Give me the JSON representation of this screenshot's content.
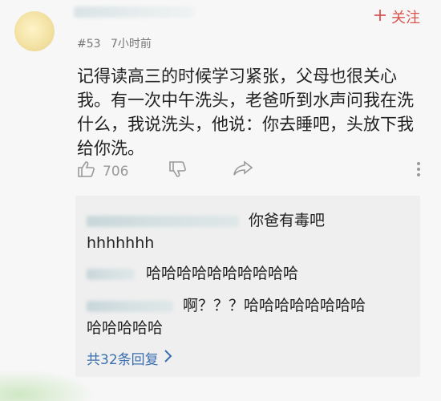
{
  "header": {
    "follow_label": "关注",
    "floor": "#53",
    "time": "7小时前"
  },
  "post": {
    "text": "记得读高三的时候学习紧张，父母也很关心我。有一次中午洗头，老爸听到水声问我在洗什么，我说洗头，他说：你去睡吧，头放下我给你洗。",
    "like_count": "706"
  },
  "replies": [
    {
      "text": "你爸有毒吧"
    },
    {
      "text": "hhhhhhh"
    },
    {
      "text": "哈哈哈哈哈哈哈哈哈哈"
    },
    {
      "text": "啊？？？哈哈哈哈哈哈哈哈"
    },
    {
      "text": "哈哈哈哈哈"
    }
  ],
  "more_replies_label": "共32条回复",
  "icons": [
    "plus-icon",
    "thumbs-up-icon",
    "thumbs-down-icon",
    "share-icon",
    "more-vertical-icon",
    "chevron-right-icon"
  ],
  "colors": {
    "accent": "#d9534f",
    "link": "#3a6fb0"
  }
}
